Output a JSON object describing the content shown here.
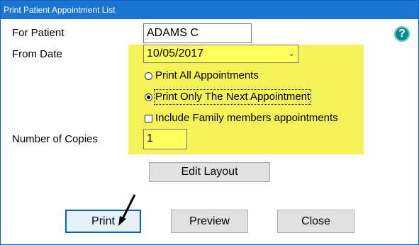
{
  "window": {
    "title": "Print Patient Appointment List"
  },
  "form": {
    "patient_label": "For Patient",
    "patient_value": "ADAMS C",
    "from_date_label": "From Date",
    "from_date_value": "10/05/2017",
    "copies_label": "Number of Copies",
    "copies_value": "1"
  },
  "options": {
    "print_all": "Print All Appointments",
    "print_next": "Print Only The Next Appointment",
    "include_family": "Include Family members appointments",
    "selected": "print_next",
    "include_family_checked": false
  },
  "buttons": {
    "edit_layout": "Edit Layout",
    "print": "Print",
    "preview": "Preview",
    "close": "Close"
  },
  "help": {
    "glyph": "?"
  },
  "colors": {
    "highlight": "#f4f45a",
    "titlebar": "#1a74d2",
    "help_icon": "#0d8a8f"
  }
}
